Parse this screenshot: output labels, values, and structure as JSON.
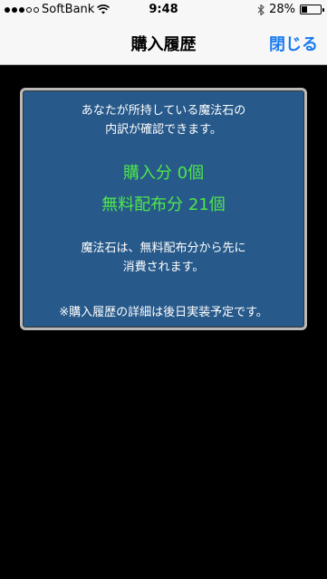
{
  "status_bar": {
    "carrier": "SoftBank",
    "time": "9:48",
    "battery_percent": "28%",
    "battery_level": 0.28,
    "signal_bars_filled": 3,
    "signal_bars_total": 5
  },
  "nav": {
    "title": "購入履歴",
    "close_label": "閉じる"
  },
  "panel": {
    "intro_line1": "あなたが所持している魔法石の",
    "intro_line2": "内訳が確認できます。",
    "purchased": "購入分 0個",
    "free": "無料配布分 21個",
    "note_line1": "魔法石は、無料配布分から先に",
    "note_line2": "消費されます。",
    "footnote": "※購入履歴の詳細は後日実装予定です。"
  },
  "colors": {
    "accent": "#1a7bf0",
    "panel_bg": "#27598a",
    "highlight": "#4ee84a"
  }
}
